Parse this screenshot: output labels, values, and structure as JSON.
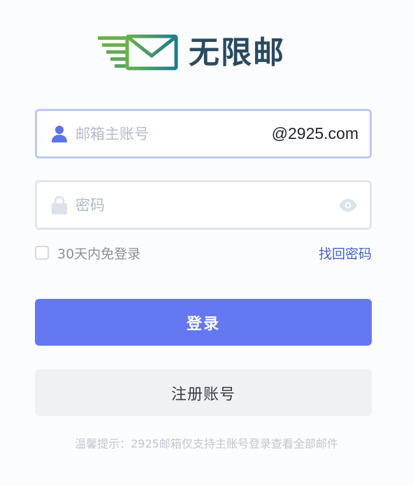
{
  "brand": {
    "name": "无限邮",
    "logo_icon": "envelope-speed-icon",
    "colors": {
      "green": "#5bae59",
      "teal": "#1f7a8c",
      "text": "#2a4a60"
    }
  },
  "account": {
    "placeholder": "邮箱主账号",
    "value": "",
    "suffix": "@2925.com",
    "icon": "user-icon"
  },
  "password": {
    "placeholder": "密码",
    "value": "",
    "icon": "lock-icon",
    "toggle_icon": "eye-icon"
  },
  "remember": {
    "label": "30天内免登录",
    "checked": false
  },
  "forgot_label": "找回密码",
  "login_label": "登录",
  "register_label": "注册账号",
  "tip": "温馨提示：2925邮箱仅支持主账号登录查看全部邮件",
  "colors": {
    "primary": "#6478f2",
    "link": "#4662c8",
    "secondary_bg": "#eff1f4"
  }
}
